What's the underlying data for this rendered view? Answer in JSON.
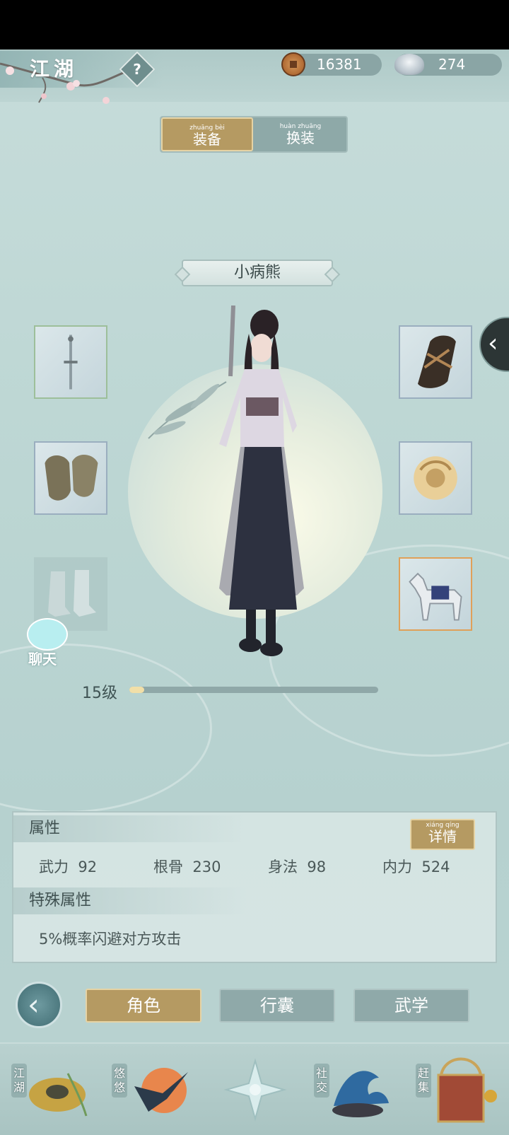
{
  "header": {
    "title": "江湖",
    "help_icon": "question-mark-icon",
    "copper_amount": "16381",
    "silver_amount": "274"
  },
  "top_tabs": [
    {
      "pinyin": "zhuāng bèi",
      "label": "装备",
      "active": true
    },
    {
      "pinyin": "huàn zhuāng",
      "label": "换装",
      "active": false
    }
  ],
  "character": {
    "name": "小病熊",
    "level_text": "15级",
    "level_progress": 0.06
  },
  "equipment": {
    "left": [
      "sword",
      "gloves",
      "boots-empty"
    ],
    "right": [
      "bracer",
      "jade-pendant",
      "horse"
    ]
  },
  "chat": {
    "label": "聊天"
  },
  "attributes": {
    "title": "属性",
    "detail_pinyin": "xiáng qíng",
    "detail_label": "详情",
    "stats": [
      {
        "name": "武力",
        "value": "92"
      },
      {
        "name": "根骨",
        "value": "230"
      },
      {
        "name": "身法",
        "value": "98"
      },
      {
        "name": "内力",
        "value": "524"
      }
    ],
    "special_title": "特殊属性",
    "special_text": "5%概率闪避对方攻击"
  },
  "menu": {
    "buttons": [
      {
        "label": "角色",
        "active": true
      },
      {
        "label": "行囊",
        "active": false
      },
      {
        "label": "武学",
        "active": false
      }
    ]
  },
  "bottom_nav": [
    {
      "label": "江湖"
    },
    {
      "label": "悠悠"
    },
    {
      "label": "社交"
    },
    {
      "label": "赶集"
    }
  ],
  "colors": {
    "accent_gold": "#b59a62",
    "panel_bg": "#c6dcda",
    "button_idle": "#8fa9a9"
  }
}
